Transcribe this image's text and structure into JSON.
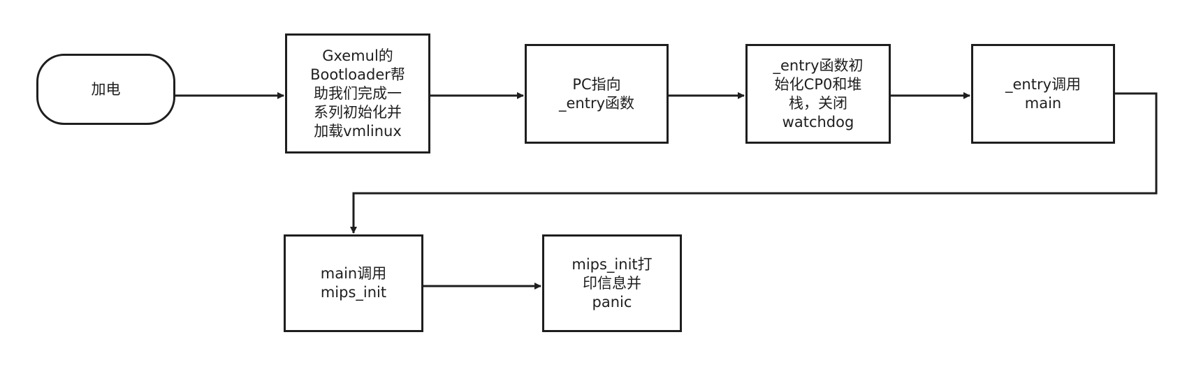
{
  "diagram": {
    "colors": {
      "stroke": "#1e1e1e",
      "fill": "#ffffff",
      "text": "#1e1e1e"
    },
    "nodes": [
      {
        "id": "power_on",
        "shape": "terminal",
        "text": "加电"
      },
      {
        "id": "gxemul_bootloader",
        "shape": "process",
        "text": "Gxemul的\nBootloader帮\n助我们完成一\n系列初始化并\n加载vmlinux"
      },
      {
        "id": "pc_to_entry",
        "shape": "process",
        "text": "PC指向\n_entry函数"
      },
      {
        "id": "entry_init",
        "shape": "process",
        "text": "_entry函数初\n始化CP0和堆\n栈，关闭\nwatchdog"
      },
      {
        "id": "entry_calls_main",
        "shape": "process",
        "text": "_entry调用\nmain"
      },
      {
        "id": "main_calls_mips_init",
        "shape": "process",
        "text": "main调用\nmips_init"
      },
      {
        "id": "mips_init_panic",
        "shape": "process",
        "text": "mips_init打\n印信息并\npanic"
      }
    ],
    "edges": [
      {
        "from": "power_on",
        "to": "gxemul_bootloader"
      },
      {
        "from": "gxemul_bootloader",
        "to": "pc_to_entry"
      },
      {
        "from": "pc_to_entry",
        "to": "entry_init"
      },
      {
        "from": "entry_init",
        "to": "entry_calls_main"
      },
      {
        "from": "entry_calls_main",
        "to": "main_calls_mips_init"
      },
      {
        "from": "main_calls_mips_init",
        "to": "mips_init_panic"
      }
    ]
  }
}
